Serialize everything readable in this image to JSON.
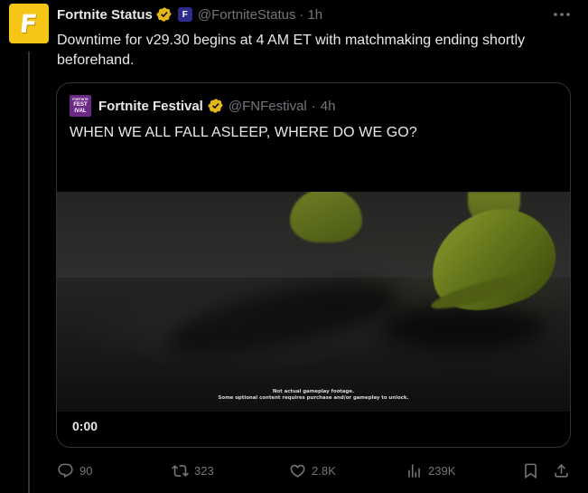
{
  "post": {
    "avatar_letter": "F",
    "display_name": "Fortnite Status",
    "affiliate_badge_letter": "F",
    "handle": "@FortniteStatus",
    "separator": "·",
    "time": "1h",
    "text": "Downtime for v29.30 begins at 4 AM ET with matchmaking ending shortly beforehand."
  },
  "quoted": {
    "avatar_lines": [
      "FORTNITE",
      "FEST",
      "IVAL"
    ],
    "display_name": "Fortnite Festival",
    "handle": "@FNFestival",
    "separator": "·",
    "time": "4h",
    "text": "WHEN WE ALL FALL ASLEEP, WHERE DO WE GO?",
    "media": {
      "disclaimer_line1": "Not actual gameplay footage.",
      "disclaimer_line2": "Some optional content requires purchase and/or gameplay to unlock.",
      "timecode": "0:00"
    }
  },
  "actions": {
    "replies": "90",
    "reposts": "323",
    "likes": "2.8K",
    "views": "239K"
  },
  "colors": {
    "background": "#000000",
    "text": "#e7e9ea",
    "muted": "#71767b",
    "verified": "#e2b719",
    "border": "#2f3336"
  },
  "icons": [
    "verified-icon",
    "more-icon",
    "reply-icon",
    "repost-icon",
    "like-icon",
    "views-icon",
    "bookmark-icon",
    "share-icon"
  ]
}
